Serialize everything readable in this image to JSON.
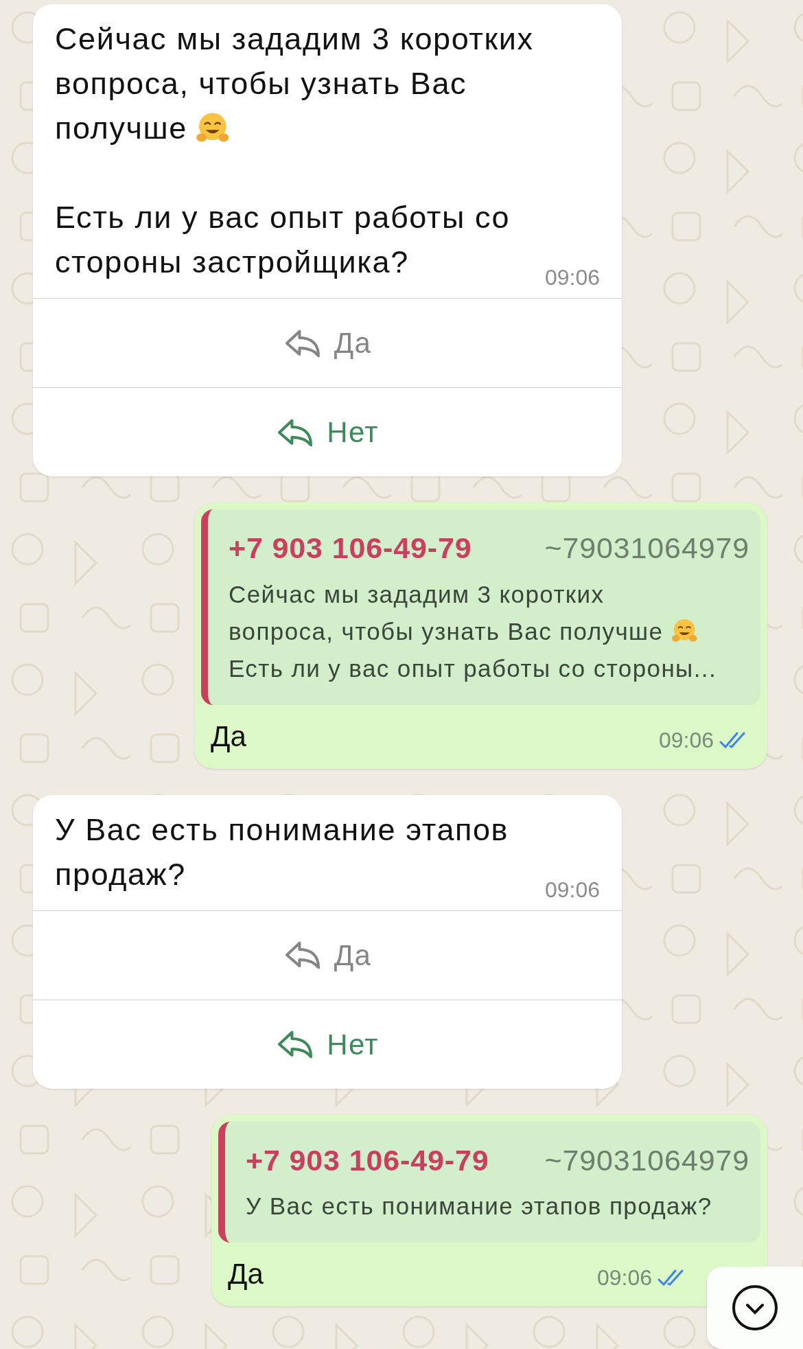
{
  "messages": [
    {
      "kind": "incoming",
      "paragraphs": [
        {
          "text": "Сейчас мы зададим 3 коротких вопроса, чтобы узнать Вас получше",
          "emoji_after": true
        },
        {
          "text": "Есть ли у вас опыт работы со стороны застройщика?",
          "emoji_after": false
        }
      ],
      "time": "09:06",
      "replies": [
        {
          "label": "Да",
          "disabled": true
        },
        {
          "label": "Нет",
          "disabled": false
        }
      ]
    },
    {
      "kind": "outgoing",
      "quote": {
        "sender": "+7 903 106-49-79",
        "handle": "~79031064979",
        "lines": [
          {
            "text": "Сейчас мы зададим 3 коротких",
            "emoji_after": false
          },
          {
            "text": "вопроса, чтобы узнать Вас получше",
            "emoji_after": true
          },
          {
            "text": "Есть ли у вас опыт работы со стороны...",
            "emoji_after": false
          }
        ]
      },
      "text": "Да",
      "time": "09:06",
      "read": true
    },
    {
      "kind": "incoming",
      "paragraphs": [
        {
          "text": "У Вас есть понимание этапов продаж?",
          "emoji_after": false
        }
      ],
      "time": "09:06",
      "replies": [
        {
          "label": "Да",
          "disabled": true
        },
        {
          "label": "Нет",
          "disabled": false
        }
      ]
    },
    {
      "kind": "outgoing",
      "quote": {
        "sender": "+7 903 106-49-79",
        "handle": "~79031064979",
        "lines": [
          {
            "text": "У Вас есть понимание этапов продаж?",
            "emoji_after": false
          }
        ]
      },
      "text": "Да",
      "time": "09:06",
      "read": true
    }
  ]
}
